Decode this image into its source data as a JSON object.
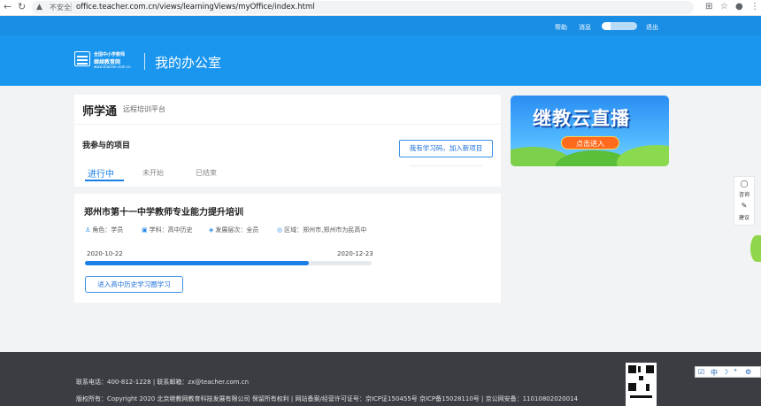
{
  "browser": {
    "insecure_label": "不安全",
    "url": "office.teacher.com.cn/views/learningViews/myOffice/index.html"
  },
  "topbar": {
    "help": "帮助",
    "messages": "消息",
    "logout": "退出"
  },
  "header": {
    "logo_line1": "全国中小学教师",
    "logo_line2": "继续教育网",
    "logo_url": "www.teacher.com.cn",
    "page_title": "我的办公室"
  },
  "brand": {
    "name": "师学通",
    "subtitle": "远程培训平台"
  },
  "projects": {
    "heading": "我参与的项目",
    "join_button": "我有学习码，加入新项目",
    "tabs": [
      "进行中",
      "未开始",
      "已结束"
    ],
    "active_tab_index": 0
  },
  "project": {
    "title": "郑州市第十一中学教师专业能力提升培训",
    "role": "角色：学员",
    "subject": "学科：高中历史",
    "level": "发展层次：全员",
    "region": "区域：郑州市,郑州市为民高中",
    "start_date": "2020-10-22",
    "end_date": "2020-12-23",
    "progress_percent": 78,
    "enter_button": "进入高中历史学习圈学习"
  },
  "banner": {
    "title": "继教云直播",
    "button": "点击进入"
  },
  "side_tools": {
    "consult": "咨询",
    "suggest": "建议"
  },
  "footer": {
    "contact": "联系电话：400-812-1228   |   联系邮箱：zx@teacher.com.cn",
    "copyright": "版权所有：Copyright 2020 北京继教网教育科技发展有限公司 保留所有权利   |   网站备案/经营许可证号：京ICP证150455号 京ICP备15028110号   |   京公网安备：11010802020014"
  },
  "ime_tray": {
    "lang": "中"
  },
  "colors": {
    "header_blue": "#1a96ef",
    "topbar_blue": "#1a8ee5",
    "accent_blue": "#1a7fe6",
    "footer_bg": "#3b3d42",
    "banner_button": "#ff6a1d"
  }
}
